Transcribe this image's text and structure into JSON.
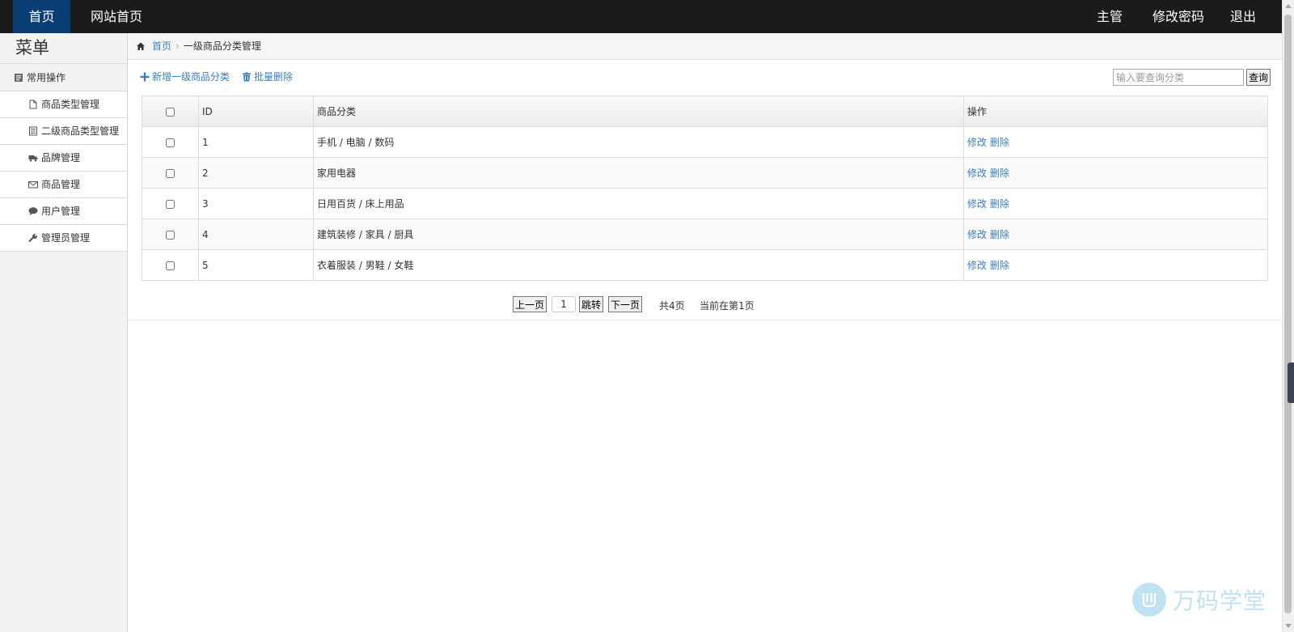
{
  "topbar": {
    "home": "首页",
    "site_home": "网站首页",
    "user": "主管",
    "change_password": "修改密码",
    "logout": "退出"
  },
  "sidebar": {
    "title": "菜单",
    "group": "常用操作",
    "items": [
      {
        "label": "商品类型管理",
        "icon": "file-icon"
      },
      {
        "label": "二级商品类型管理",
        "icon": "list-icon"
      },
      {
        "label": "品牌管理",
        "icon": "truck-icon"
      },
      {
        "label": "商品管理",
        "icon": "envelope-icon"
      },
      {
        "label": "用户管理",
        "icon": "comment-icon"
      },
      {
        "label": "管理员管理",
        "icon": "wrench-icon"
      }
    ]
  },
  "breadcrumb": {
    "home": "首页",
    "current": "一级商品分类管理"
  },
  "toolbar": {
    "add": "新增一级商品分类",
    "batch_delete": "批量删除"
  },
  "search": {
    "placeholder": "输入要查询分类",
    "button": "查询"
  },
  "table": {
    "headers": {
      "id": "ID",
      "name": "商品分类",
      "ops": "操作"
    },
    "rows": [
      {
        "id": "1",
        "name": "手机 / 电脑 / 数码",
        "edit": "修改",
        "delete": "删除"
      },
      {
        "id": "2",
        "name": "家用电器",
        "edit": "修改",
        "delete": "删除"
      },
      {
        "id": "3",
        "name": "日用百货 / 床上用品",
        "edit": "修改",
        "delete": "删除"
      },
      {
        "id": "4",
        "name": "建筑装修 / 家具 / 厨具",
        "edit": "修改",
        "delete": "删除"
      },
      {
        "id": "5",
        "name": "衣着服装 / 男鞋 / 女鞋",
        "edit": "修改",
        "delete": "删除"
      }
    ]
  },
  "pager": {
    "prev": "上一页",
    "page_value": "1",
    "go": "跳转",
    "next": "下一页",
    "total": "共4页",
    "current": "当前在第1页"
  },
  "watermark": {
    "text": "万码学堂"
  },
  "colors": {
    "topbar": "#1b1b1b",
    "active_nav": "#0b3d75",
    "link": "#3a7ec0"
  }
}
